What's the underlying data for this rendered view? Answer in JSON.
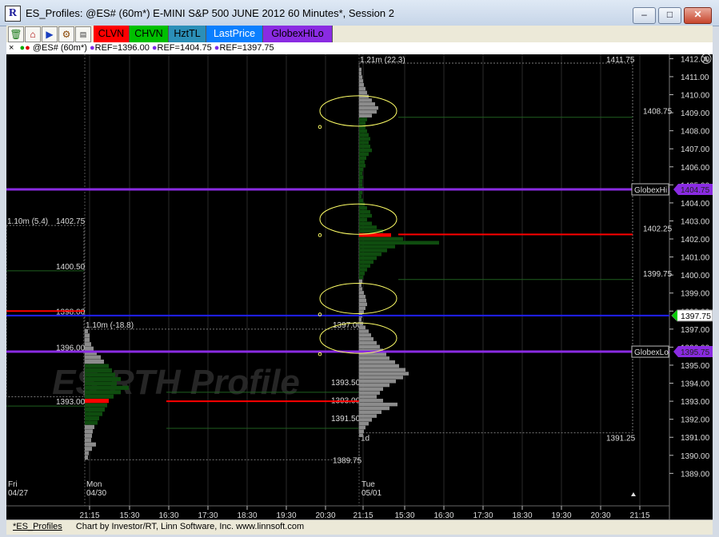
{
  "window": {
    "title": "ES_Profiles: @ES# (60m*) E-MINI S&P 500 JUNE 2012 60 Minutes*, Session 2",
    "app_icon": "R",
    "minimize": "–",
    "maximize": "□",
    "close": "✕"
  },
  "toolbar": {
    "icons": [
      "trash-icon",
      "home-icon",
      "play-icon",
      "gear-icon",
      "table-icon"
    ],
    "buttons": [
      {
        "label": "CLVN",
        "bg": "#ff0000",
        "fg": "#000000"
      },
      {
        "label": "CHVN",
        "bg": "#00c000",
        "fg": "#000000"
      },
      {
        "label": "HztTL",
        "bg": "#2b8fb8",
        "fg": "#000000"
      },
      {
        "label": "LastPrice",
        "bg": "#0a7fff",
        "fg": "#ffffff"
      },
      {
        "label": "GlobexHiLo",
        "bg": "#8a2be2",
        "fg": "#000000"
      }
    ]
  },
  "infobar": {
    "close": "×",
    "symbol": "@ES# (60m*)",
    "refs": [
      "REF=1396.00",
      "REF=1404.75",
      "REF=1397.75"
    ],
    "ref_color": "#7d2ae8"
  },
  "chart": {
    "watermark": "ES   RTH Profile",
    "price_axis": {
      "min": 1388.75,
      "max": 1412.15,
      "labels": [
        "1412.00",
        "1411.00",
        "1410.00",
        "1409.00",
        "1408.00",
        "1407.00",
        "1406.00",
        "1405.00",
        "1404.00",
        "1403.00",
        "1402.00",
        "1401.00",
        "1400.00",
        "1399.00",
        "1398.00",
        "1397.00",
        "1396.00",
        "1395.00",
        "1394.00",
        "1393.00",
        "1392.00",
        "1391.00",
        "1390.00",
        "1389.00"
      ],
      "letter": "A"
    },
    "current_price": {
      "value": 1397.75,
      "label": "1397.75",
      "color": "#2020ff"
    },
    "globex": {
      "hi": {
        "value": 1404.75,
        "label": "GlobexHi",
        "axis_label": "1404.75"
      },
      "lo": {
        "value": 1395.75,
        "label": "GlobexLo",
        "axis_label": "1395.75"
      },
      "color": "#8a2be2"
    },
    "time_axis": [
      "21:15",
      "15:30",
      "16:30",
      "17:30",
      "18:30",
      "19:30",
      "20:30",
      "21:15",
      "15:30",
      "16:30",
      "17:30",
      "18:30",
      "19:30",
      "20:30",
      "21:15"
    ],
    "days": [
      {
        "name": "Fri",
        "date": "04/27"
      },
      {
        "name": "Mon",
        "date": "04/30"
      },
      {
        "name": "Tue",
        "date": "05/01"
      }
    ],
    "profiles": [
      {
        "header": "1.10m (5.4)",
        "high": "1402.75",
        "low": "",
        "labels": [
          "1400.50",
          "1398.00",
          "1396.00",
          "1393.00"
        ],
        "poc": 1398.0
      },
      {
        "header": "1.10m (-18.8)",
        "high": "1397.00",
        "low": "1389.75",
        "labels": [
          "1393.50",
          "1393.00",
          "1391.50"
        ],
        "poc": 1393.0,
        "hist_min": 1389.75,
        "hist_max": 1397.0,
        "widths": [
          4,
          6,
          6,
          8,
          11,
          15,
          20,
          24,
          30,
          34,
          38,
          45,
          40,
          55,
          45,
          36,
          30,
          28,
          25,
          22,
          18,
          16,
          12,
          10,
          9,
          8,
          14,
          9,
          5,
          4
        ]
      },
      {
        "header": "1.21m (22.3)",
        "high": "1411.75",
        "low": "1391.25",
        "labels": [
          "1408.75",
          "1402.25",
          "1399.75"
        ],
        "poc": 1402.25,
        "flag": "1d",
        "hist_min": 1391.0,
        "hist_max": 1411.5,
        "widths": [
          3,
          3,
          4,
          5,
          6,
          8,
          10,
          12,
          16,
          20,
          24,
          22,
          16,
          10,
          8,
          8,
          10,
          12,
          14,
          12,
          14,
          16,
          12,
          9,
          7,
          8,
          5,
          4,
          5,
          4,
          4,
          6,
          4,
          3,
          5,
          7,
          10,
          14,
          16,
          10,
          16,
          22,
          30,
          40,
          55,
          100,
          45,
          35,
          28,
          22,
          18,
          14,
          10,
          7,
          5,
          4,
          3,
          4,
          6,
          8,
          9,
          10,
          8,
          6,
          4,
          3,
          5,
          8,
          12,
          15,
          18,
          22,
          26,
          30,
          34,
          38,
          45,
          50,
          58,
          62,
          55,
          46,
          38,
          30,
          26,
          22,
          30,
          48,
          38,
          28,
          22,
          16,
          12,
          8,
          6,
          5
        ]
      }
    ],
    "ellipse_color": "#ffff66"
  },
  "statusbar": {
    "tab": "*ES_Profiles",
    "credit": "Chart by Investor/RT, Linn Software, Inc. www.linnsoft.com"
  }
}
